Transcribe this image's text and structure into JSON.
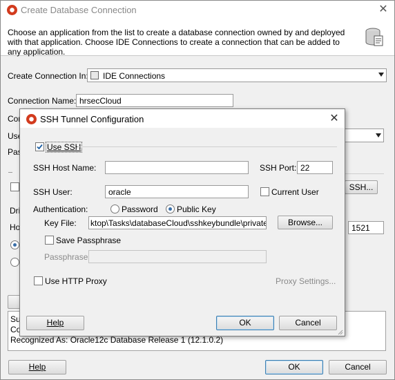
{
  "main": {
    "title": "Create Database Connection",
    "description": "Choose an application from the list to create a database connection owned by and deployed with that application. Choose IDE Connections to create a connection that can be added to any application.",
    "create_in_label": "Create Connection In:",
    "create_in_value": "IDE Connections",
    "conn_name_label": "Connection Name:",
    "conn_name_value": "hrsecCloud",
    "partial_labels": [
      "Cor",
      "Use",
      "Pas",
      "Dri",
      "Ho"
    ],
    "ssh_button": "SSH...",
    "port_value": "1521",
    "status_lines": [
      "Su",
      "Co",
      "Recognized As: Oracle12c Database Release 1 (12.1.0.2)"
    ],
    "help_button": "Help",
    "ok_button": "OK",
    "cancel_button": "Cancel"
  },
  "ssh_dialog": {
    "title": "SSH Tunnel Configuration",
    "use_ssh_label": "Use SSH",
    "use_ssh_checked": true,
    "host_label": "SSH Host Name:",
    "host_value": "",
    "port_label": "SSH Port:",
    "port_value": "22",
    "user_label": "SSH User:",
    "user_value": "oracle",
    "current_user_label": "Current User",
    "auth_label": "Authentication:",
    "auth_password": "Password",
    "auth_public_key": "Public Key",
    "auth_selected": "Public Key",
    "key_file_label": "Key File:",
    "key_file_value": "ktop\\Tasks\\databaseCloud\\sshkeybundle\\privateKey",
    "browse_button": "Browse...",
    "save_passphrase_label": "Save Passphrase",
    "passphrase_label": "Passphrase",
    "use_http_proxy_label": "Use HTTP Proxy",
    "proxy_settings_link": "Proxy Settings...",
    "help_button": "Help",
    "ok_button": "OK",
    "cancel_button": "Cancel"
  },
  "icons": {
    "app_logo": "oracle-logo-icon",
    "close": "close-icon",
    "database": "database-icon"
  },
  "colors": {
    "accent": "#3c7fb1",
    "logo_red": "#d23b1e"
  }
}
